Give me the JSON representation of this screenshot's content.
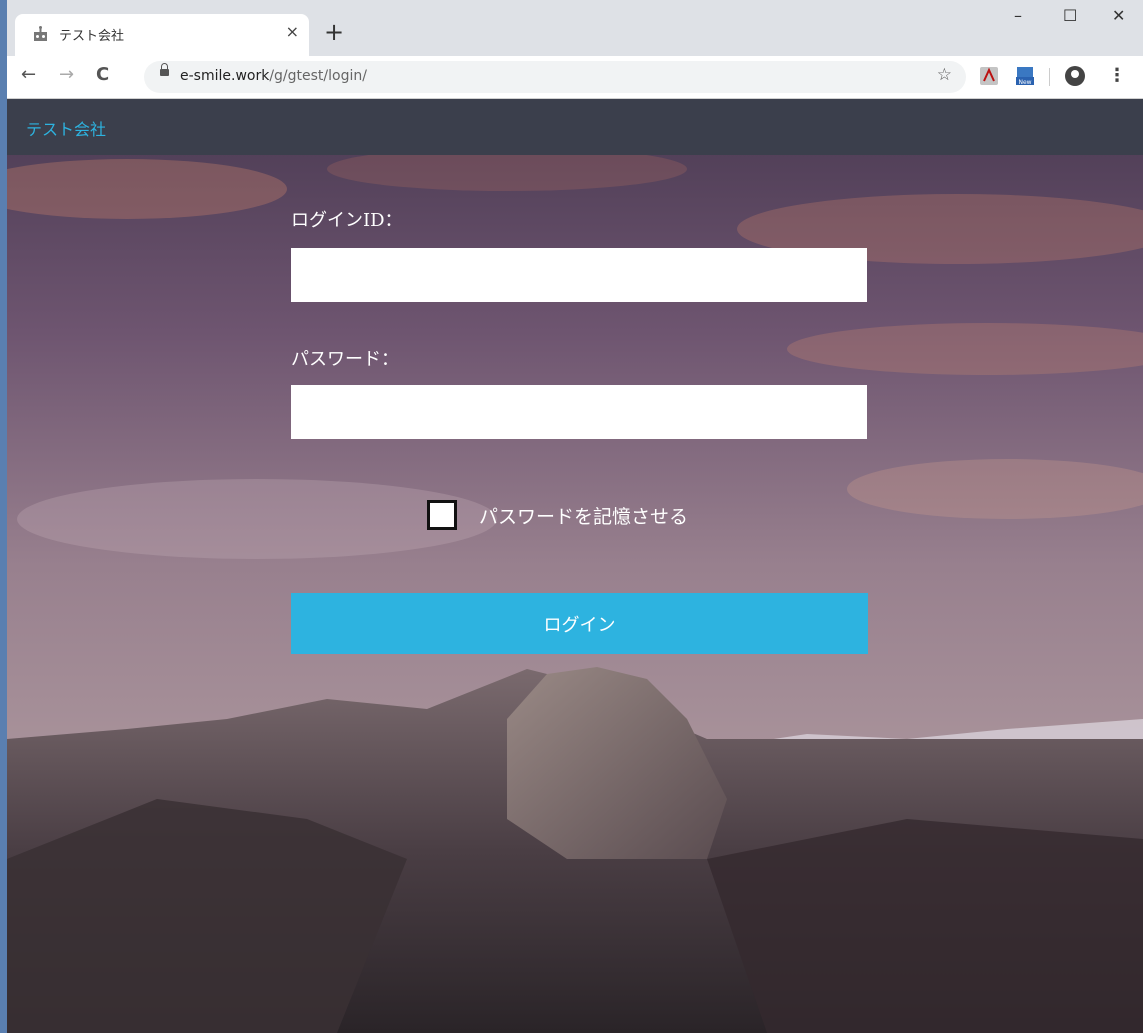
{
  "browser": {
    "tab": {
      "title": "テスト会社",
      "close_glyph": "×",
      "favicon": "robot-icon"
    },
    "new_tab_glyph": "+",
    "window_controls": {
      "minimize": "–",
      "maximize": "☐",
      "close": "✕"
    },
    "nav": {
      "back": "←",
      "forward": "→",
      "reload": "C"
    },
    "url": {
      "host": "e-smile.work",
      "path": "/g/gtest/login/"
    },
    "star_glyph": "☆",
    "extensions": [
      "acrobat-icon",
      "new-extension-icon"
    ],
    "menu_glyph": "⋮"
  },
  "app": {
    "brand": "テスト会社",
    "brand_color": "#2db3e0",
    "header_color": "#3b3f4c"
  },
  "login_form": {
    "login_id_label": "ログインID：",
    "login_id_value": "",
    "password_label": "パスワード：",
    "password_value": "",
    "remember_label": "パスワードを記憶させる",
    "remember_checked": false,
    "submit_label": "ログイン",
    "submit_color": "#2db3e0"
  }
}
